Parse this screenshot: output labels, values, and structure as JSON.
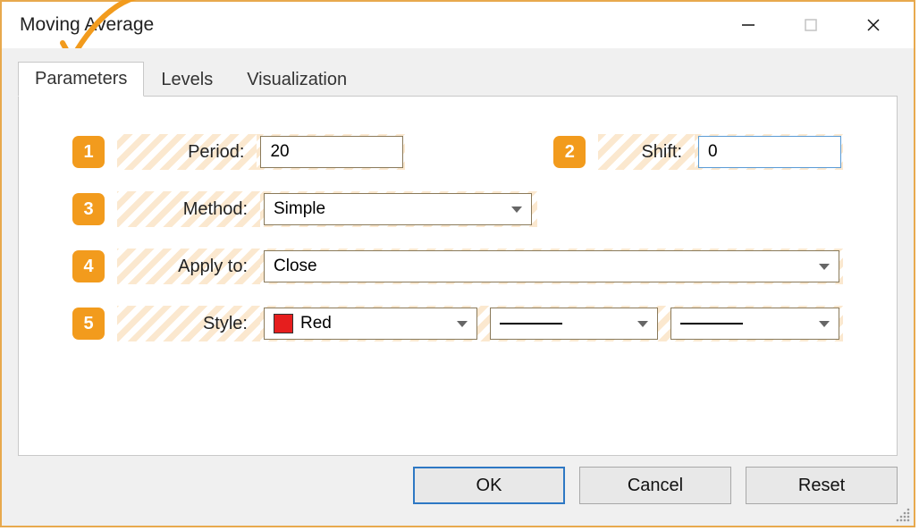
{
  "window": {
    "title": "Moving Average"
  },
  "tabs": [
    {
      "label": "Parameters",
      "active": true
    },
    {
      "label": "Levels",
      "active": false
    },
    {
      "label": "Visualization",
      "active": false
    }
  ],
  "badges": {
    "b1": "1",
    "b2": "2",
    "b3": "3",
    "b4": "4",
    "b5": "5"
  },
  "fields": {
    "period_label": "Period:",
    "period_value": "20",
    "shift_label": "Shift:",
    "shift_value": "0",
    "method_label": "Method:",
    "method_value": "Simple",
    "applyto_label": "Apply to:",
    "applyto_value": "Close",
    "style_label": "Style:",
    "style_color_name": "Red",
    "style_color_hex": "#e61e1e"
  },
  "buttons": {
    "ok": "OK",
    "cancel": "Cancel",
    "reset": "Reset"
  }
}
